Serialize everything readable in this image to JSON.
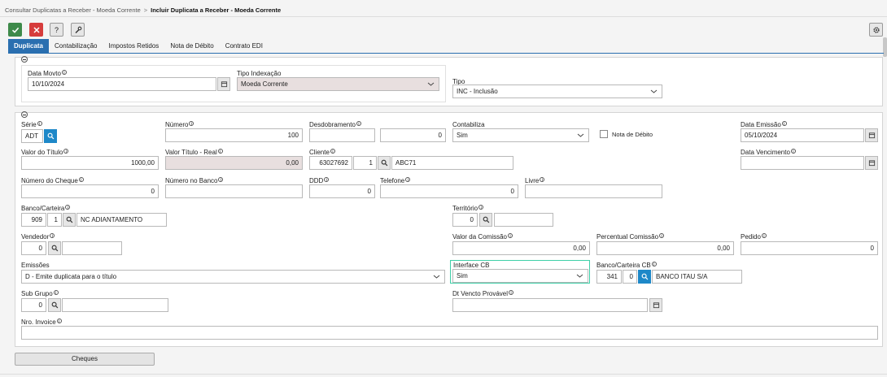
{
  "breadcrumb": {
    "parent": "Consultar Duplicatas a Receber - Moeda Corrente",
    "separator": ">",
    "current": "Incluir Duplicata a Receber - Moeda Corrente"
  },
  "toolbar": {
    "save_icon": "check-icon",
    "cancel_icon": "x-icon",
    "help_label": "?",
    "tools_icon": "wrench-icon",
    "settings_icon": "gear-icon"
  },
  "tabs": [
    "Duplicata",
    "Contabilização",
    "Impostos Retidos",
    "Nota de Débito",
    "Contrato EDI"
  ],
  "colors": {
    "accent": "#2a6fb0",
    "save": "#3e8a4a",
    "cancel": "#d63c3c",
    "readonly": "#e8dfdf",
    "search": "#1e88c8",
    "focus": "#3fcfa8"
  },
  "section1": {
    "data_movto": {
      "label": "Data Movto",
      "value": "10/10/2024"
    },
    "tipo_indexacao": {
      "label": "Tipo Indexação",
      "value": "Moeda Corrente"
    },
    "tipo": {
      "label": "Tipo",
      "value": "INC - Inclusão"
    }
  },
  "section2": {
    "serie": {
      "label": "Série",
      "value": "ADT"
    },
    "numero": {
      "label": "Número",
      "value": "100"
    },
    "desdobramento": {
      "label": "Desdobramento",
      "value": "",
      "value2": "0"
    },
    "contabiliza": {
      "label": "Contabiliza",
      "value": "Sim"
    },
    "nota_debito": {
      "label": "Nota de Débito"
    },
    "data_emissao": {
      "label": "Data Emissão",
      "value": "05/10/2024"
    },
    "valor_titulo": {
      "label": "Valor do Título",
      "value": "1000,00"
    },
    "valor_titulo_real": {
      "label": "Valor Título - Real",
      "value": "0,00"
    },
    "cliente": {
      "label": "Cliente",
      "code": "63027692",
      "seq": "1",
      "name": "ABC71"
    },
    "data_vencimento": {
      "label": "Data Vencimento",
      "value": ""
    },
    "numero_cheque": {
      "label": "Número do Cheque",
      "value": "0"
    },
    "numero_banco": {
      "label": "Número no Banco",
      "value": ""
    },
    "ddd": {
      "label": "DDD",
      "value": "0"
    },
    "telefone": {
      "label": "Telefone",
      "value": "0"
    },
    "livre": {
      "label": "Livre",
      "value": ""
    },
    "banco_carteira": {
      "label": "Banco/Carteira",
      "banco": "909",
      "carteira": "1",
      "name": "NC ADIANTAMENTO"
    },
    "territorio": {
      "label": "Território",
      "value": "0",
      "name": ""
    },
    "vendedor": {
      "label": "Vendedor",
      "value": "0",
      "name": ""
    },
    "valor_comissao": {
      "label": "Valor da Comissão",
      "value": "0,00"
    },
    "percentual_comissao": {
      "label": "Percentual Comissão",
      "value": "0,00"
    },
    "pedido": {
      "label": "Pedido",
      "value": "0"
    },
    "emissoes": {
      "label": "Emissões",
      "value": "D - Emite duplicata para o título"
    },
    "interface_cb": {
      "label": "Interface CB",
      "value": "Sim"
    },
    "banco_carteira_cb": {
      "label": "Banco/Carteira CB",
      "banco": "341",
      "carteira": "0",
      "name": "BANCO ITAU S/A"
    },
    "sub_grupo": {
      "label": "Sub Grupo",
      "value": "0",
      "name": ""
    },
    "dt_vencto_provavel": {
      "label": "Dt Vencto Provável",
      "value": ""
    },
    "nro_invoice": {
      "label": "Nro. Invoice",
      "value": ""
    }
  },
  "cheques_button": "Cheques"
}
